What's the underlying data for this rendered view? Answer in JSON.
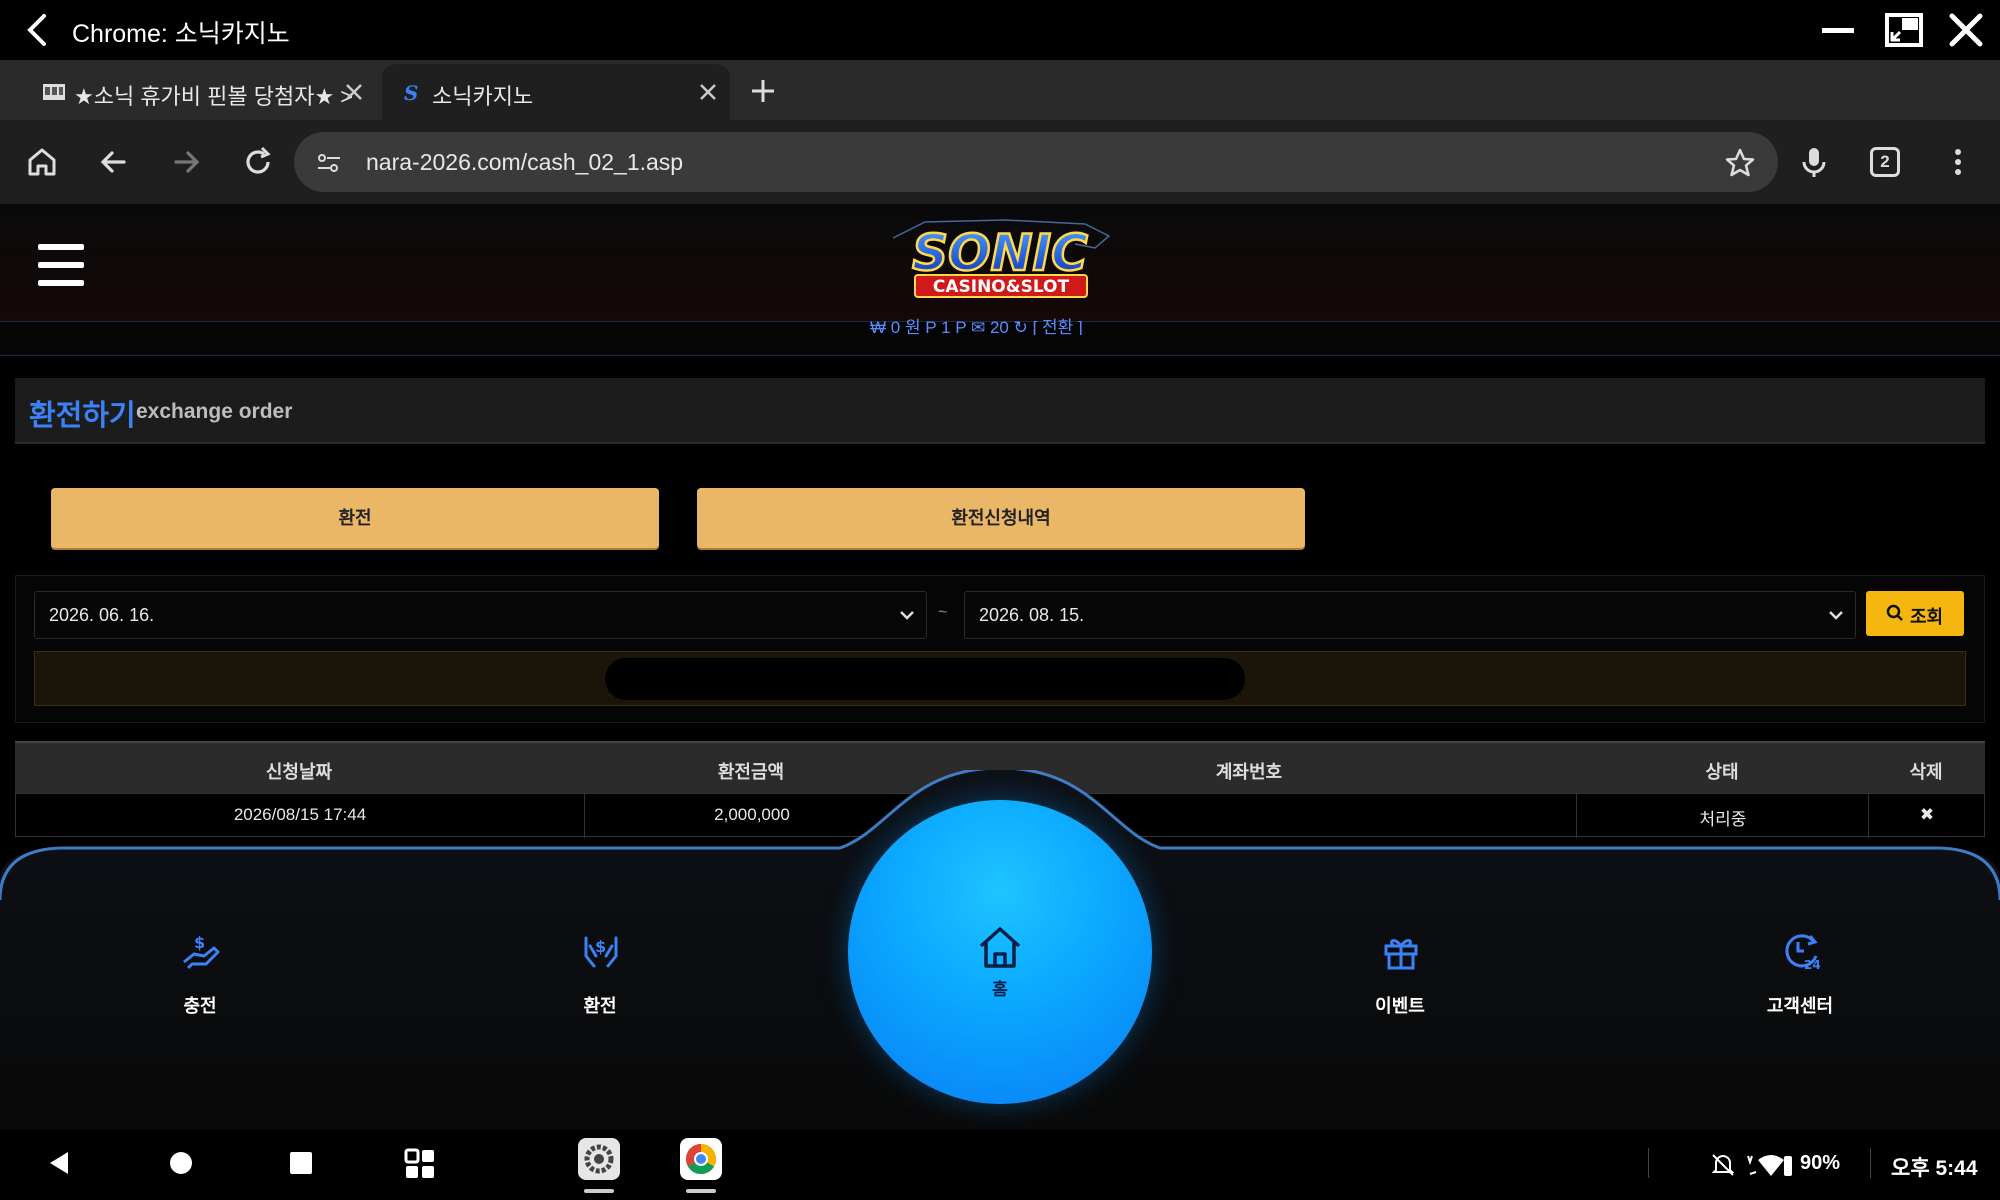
{
  "window": {
    "title": "Chrome: 소닉카지노"
  },
  "tabs": [
    {
      "label": "★소닉 휴가비 핀볼 당첨자★ >"
    },
    {
      "label": "소닉카지노"
    }
  ],
  "omnibox": {
    "url": "nara-2026.com/cash_02_1.asp",
    "tab_count": "2"
  },
  "site": {
    "logo_top": "SONIC",
    "logo_bottom": "CASINO&SLOT",
    "balance_line": "₩ 0 원   P 1 P   ✉ 20 ↻ [ 전환 ]"
  },
  "section": {
    "title_ko": "환전하기",
    "title_en": "exchange order"
  },
  "buttons": {
    "exchange": "환전",
    "history": "환전신청내역",
    "search": "조회"
  },
  "filter": {
    "date_from": "2026. 06. 16.",
    "date_to": "2026. 08. 15.",
    "separator": "~"
  },
  "table": {
    "headers": [
      "신청날짜",
      "환전금액",
      "계좌번호",
      "상태",
      "삭제"
    ],
    "rows": [
      {
        "date": "2026/08/15 17:44",
        "amount": "2,000,000",
        "status": "처리중",
        "delete": "✖"
      }
    ]
  },
  "bottom_nav": {
    "charge": "충전",
    "exchange": "환전",
    "home": "홈",
    "event": "이벤트",
    "support": "고객센터"
  },
  "status": {
    "battery": "90%",
    "time": "오후 5:44"
  },
  "colors": {
    "accent_blue": "#3b82f6",
    "button_orange": "#e9b765",
    "search_yellow": "#f5b70f",
    "home_cyan": "#0aa6ff"
  }
}
